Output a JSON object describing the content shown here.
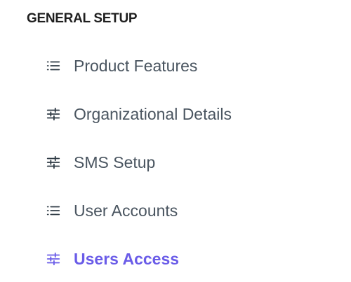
{
  "section": {
    "title": "GENERAL SETUP"
  },
  "menu": {
    "items": [
      {
        "label": "Product Features",
        "icon": "list-icon"
      },
      {
        "label": "Organizational Details",
        "icon": "sliders-icon"
      },
      {
        "label": "SMS Setup",
        "icon": "sliders-icon"
      },
      {
        "label": "User Accounts",
        "icon": "list-icon"
      },
      {
        "label": "Users Access",
        "icon": "sliders-icon",
        "active": true
      }
    ]
  },
  "colors": {
    "active": "#6a5ce8",
    "text": "#4a5560",
    "title": "#1f1f1f",
    "icon": "#2f3b45"
  }
}
